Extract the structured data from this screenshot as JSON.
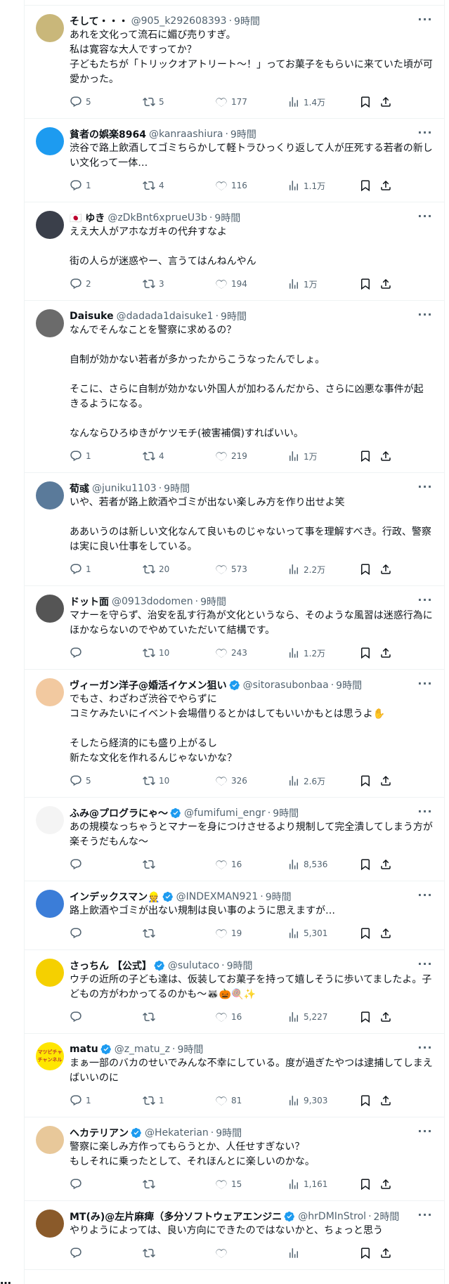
{
  "side_more": "…",
  "tweets": [
    {
      "name": "そして・・・",
      "handle": "@905_k292608393",
      "time": "9時間",
      "verified": false,
      "text": "あれを文化って流石に媚び売りすぎ。\n私は寛容な大人ですってか？\n子どもたちが「トリックオアトリート〜！」ってお菓子をもらいに来ていた頃が可愛かった。",
      "reply": "5",
      "retweet": "5",
      "like": "177",
      "views": "1.4万",
      "avatar_color": "#c9b77a"
    },
    {
      "name": "貧者の娯楽8964",
      "handle": "@kanraashiura",
      "time": "9時間",
      "verified": false,
      "text": "渋谷で路上飲酒してゴミちらかして軽トラひっくり返して人が圧死する若者の新しい文化って一体…",
      "reply": "1",
      "retweet": "4",
      "like": "116",
      "views": "1.1万",
      "avatar_color": "#1d9bf0"
    },
    {
      "name": "🇯🇵 ゆき",
      "handle": "@zDkBnt6xprueU3b",
      "time": "9時間",
      "verified": false,
      "text": "ええ大人がアホなガキの代弁すなよ\n\n街の人らが迷惑やー、言うてはんねんやん",
      "reply": "2",
      "retweet": "3",
      "like": "194",
      "views": "1万",
      "avatar_color": "#3a3f4a"
    },
    {
      "name": "Daisuke",
      "handle": "@dadada1daisuke1",
      "time": "9時間",
      "verified": false,
      "text": "なんでそんなことを警察に求めるの？\n\n自制が効かない若者が多かったからこうなったんでしょ。\n\nそこに、さらに自制が効かない外国人が加わるんだから、さらに凶悪な事件が起きるようになる。\n\nなんならひろゆきがケツモチ(被害補償)すればいい。",
      "reply": "1",
      "retweet": "4",
      "like": "219",
      "views": "1万",
      "avatar_color": "#6b6b6b"
    },
    {
      "name": "荀彧",
      "handle": "@juniku1103",
      "time": "9時間",
      "verified": false,
      "text": "いや、若者が路上飲酒やゴミが出ない楽しみ方を作り出せよ笑\n\nああいうのは新しい文化なんて良いものじゃないって事を理解すべき。行政、警察は実に良い仕事をしている。",
      "reply": "1",
      "retweet": "20",
      "like": "573",
      "views": "2.2万",
      "avatar_color": "#5a7a9a"
    },
    {
      "name": "ドット面",
      "handle": "@0913dodomen",
      "time": "9時間",
      "verified": false,
      "text": "マナーを守らず、治安を乱す行為が文化というなら、そのような風習は迷惑行為にほかならないのでやめていただいて結構です。",
      "reply": "",
      "retweet": "10",
      "like": "243",
      "views": "1.2万",
      "avatar_color": "#555555"
    },
    {
      "name": "ヴィーガン洋子@婚活イケメン狙い",
      "handle": "@sitorasubonbaa",
      "time": "9時間",
      "verified": true,
      "text": "でもさ、わざわざ渋谷でやらずに\nコミケみたいにイベント会場借りるとかはしてもいいかもとは思うよ✋\n\nそしたら経済的にも盛り上がるし\n新たな文化を作れるんじゃないかな？",
      "reply": "5",
      "retweet": "10",
      "like": "326",
      "views": "2.6万",
      "avatar_color": "#f2c9a0"
    },
    {
      "name": "ふみ@プログラにゃ〜",
      "handle": "@fumifumi_engr",
      "time": "9時間",
      "verified": true,
      "text": "あの規模なっちゃうとマナーを身につけさせるより規制して完全潰してしまう方が楽そうだもんな〜",
      "reply": "",
      "retweet": "",
      "like": "16",
      "views": "8,536",
      "avatar_color": "#f4f4f4"
    },
    {
      "name": "インデックスマン👷",
      "handle": "@INDEXMAN921",
      "time": "9時間",
      "verified": true,
      "text": "路上飲酒やゴミが出ない規制は良い事のように思えますが…",
      "reply": "",
      "retweet": "",
      "like": "19",
      "views": "5,301",
      "avatar_color": "#3b7dd8"
    },
    {
      "name": "さっちん 【公式】",
      "handle": "@sulutaco",
      "time": "9時間",
      "verified": true,
      "text": "ウチの近所の子ども達は、仮装してお菓子を持って嬉しそうに歩いてましたよ。子どもの方がわかってるのかも〜🦝🎃🍭✨",
      "reply": "",
      "retweet": "",
      "like": "16",
      "views": "5,227",
      "avatar_color": "#f5d000"
    },
    {
      "name": "matu",
      "handle": "@z_matu_z",
      "time": "9時間",
      "verified": true,
      "text": "まぁ一部のバカのせいでみんな不幸にしている。度が過ぎたやつは逮捕してしまえばいいのに",
      "reply": "1",
      "retweet": "1",
      "like": "81",
      "views": "9,303",
      "avatar_color": "#ffe600",
      "avatar_text": "マツピチャ\nチャンネル"
    },
    {
      "name": "ヘカテリアン",
      "handle": "@Hekaterian",
      "time": "9時間",
      "verified": true,
      "text": "警察に楽しみ方作ってもらうとか、人任せすぎない？\nもしそれに乗ったとして、それほんとに楽しいのかな。",
      "reply": "",
      "retweet": "",
      "like": "15",
      "views": "1,161",
      "avatar_color": "#e8c89a"
    },
    {
      "name": "MT(み)@左片麻痺（多分ソフトウェアエンジニ",
      "handle": "@hrDMInStrol",
      "time": "2時間",
      "verified": true,
      "text": "やりようによっては、良い方向にできたのではないかと、ちょっと思う",
      "reply": "",
      "retweet": "",
      "like": "",
      "views": "",
      "avatar_color": "#8a5a2a"
    }
  ]
}
